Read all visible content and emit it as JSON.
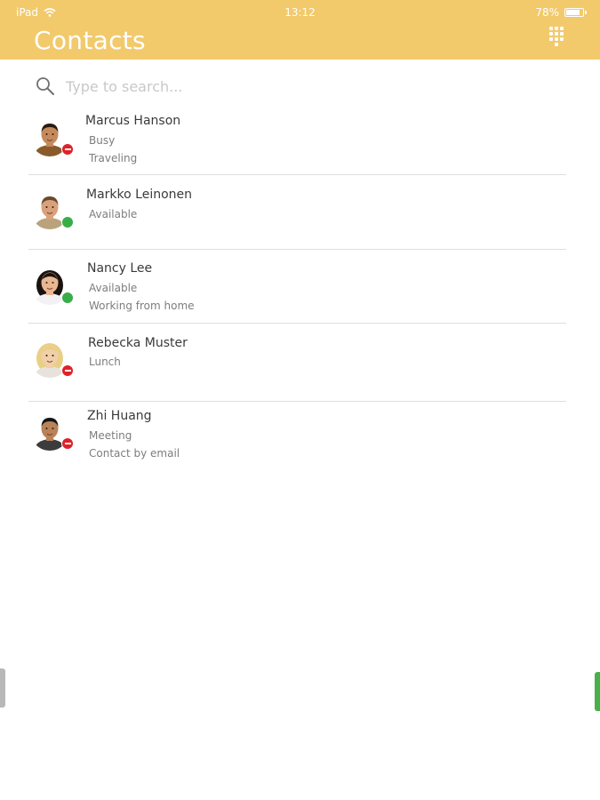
{
  "status_bar": {
    "device": "iPad",
    "time": "13:12",
    "battery": "78%",
    "battery_level": 0.78
  },
  "header": {
    "title": "Contacts",
    "dialpad_icon": "dialpad-icon"
  },
  "search": {
    "placeholder": "Type to search...",
    "value": "",
    "icon": "search-icon"
  },
  "contacts": [
    {
      "name": "Marcus Hanson",
      "status": "Busy",
      "note": "Traveling",
      "presence": "busy",
      "presence_color": "#e0212b"
    },
    {
      "name": "Markko Leinonen",
      "status": "Available",
      "note": "",
      "presence": "available",
      "presence_color": "#39ad48"
    },
    {
      "name": "Nancy Lee",
      "status": "Available",
      "note": "Working from home",
      "presence": "available",
      "presence_color": "#39ad48"
    },
    {
      "name": "Rebecka Muster",
      "status": "Lunch",
      "note": "",
      "presence": "busy",
      "presence_color": "#e0212b"
    },
    {
      "name": "Zhi Huang",
      "status": "Meeting",
      "note": "Contact by email",
      "presence": "busy",
      "presence_color": "#e0212b"
    }
  ],
  "colors": {
    "header": "#f2ca6c",
    "divider": "#dddddd",
    "busy": "#e0212b",
    "available": "#39ad48"
  }
}
